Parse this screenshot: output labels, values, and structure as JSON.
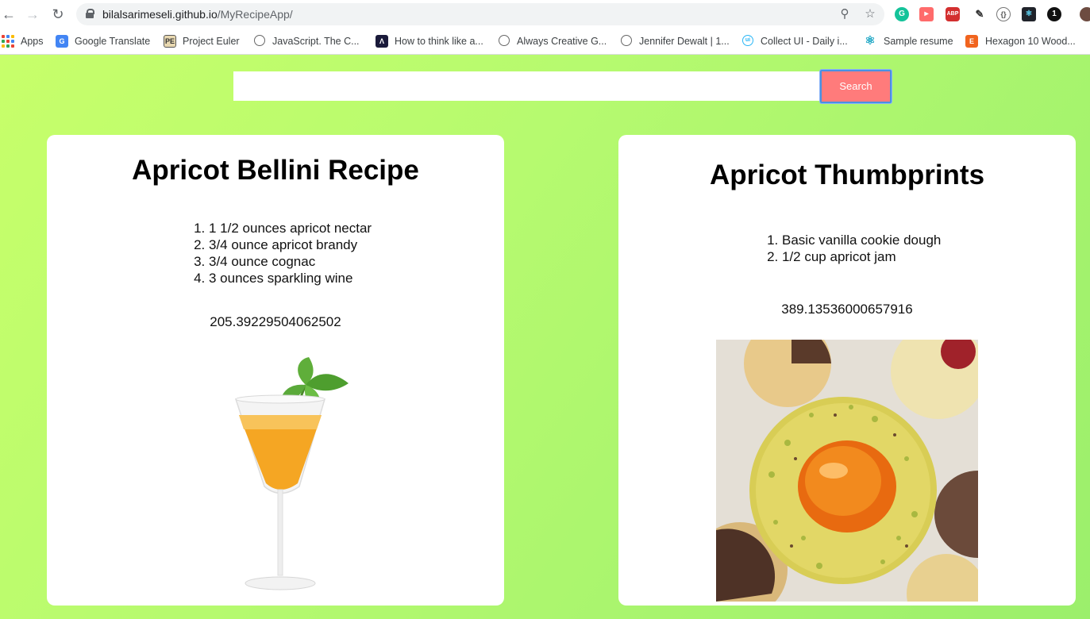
{
  "browser": {
    "url_domain": "bilalsarimeseli.github.io",
    "url_path": "/MyRecipeApp/",
    "bookmarks": [
      {
        "label": "Apps",
        "icon": "apps-grid-icon"
      },
      {
        "label": "Google Translate",
        "icon": "google-translate-icon"
      },
      {
        "label": "Project Euler",
        "icon": "project-euler-icon"
      },
      {
        "label": "JavaScript. The C...",
        "icon": "globe-icon"
      },
      {
        "label": "How to think like a...",
        "icon": "book-icon"
      },
      {
        "label": "Always Creative G...",
        "icon": "globe-icon"
      },
      {
        "label": "Jennifer Dewalt | 1...",
        "icon": "globe-icon"
      },
      {
        "label": "Collect UI - Daily i...",
        "icon": "collect-ui-icon"
      },
      {
        "label": "Sample resume",
        "icon": "react-icon"
      },
      {
        "label": "Hexagon 10 Wood...",
        "icon": "etsy-icon"
      }
    ]
  },
  "search": {
    "value": "",
    "button_label": "Search"
  },
  "recipes": [
    {
      "title": "Apricot Bellini Recipe",
      "ingredients": [
        "1 1/2 ounces apricot nectar",
        "3/4 ounce apricot brandy",
        "3/4 ounce cognac",
        "3 ounces sparkling wine"
      ],
      "calories": "205.39229504062502"
    },
    {
      "title": "Apricot Thumbprints",
      "ingredients": [
        "Basic vanilla cookie dough",
        "1/2 cup apricot jam"
      ],
      "calories": "389.13536000657916"
    }
  ],
  "colors": {
    "search_button": "#ff7b7b",
    "page_gradient_start": "#c7ff6a",
    "page_gradient_end": "#9bef6c"
  }
}
